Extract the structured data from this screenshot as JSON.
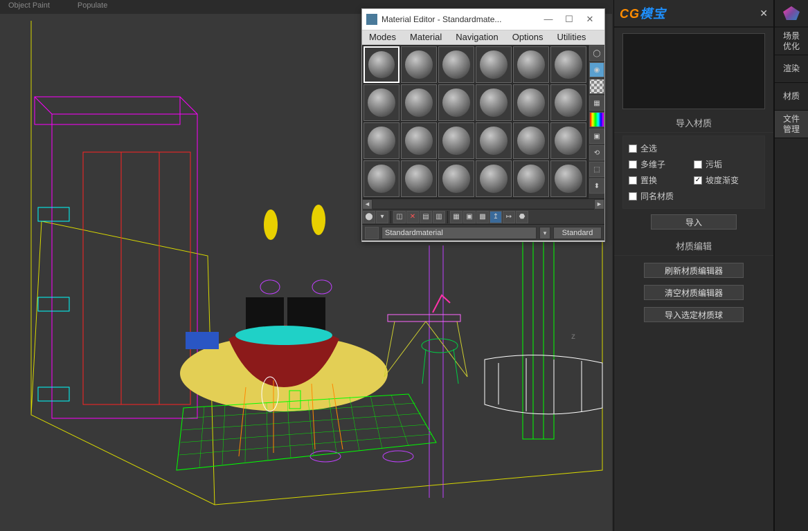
{
  "viewport": {
    "toolbar_items": [
      "Object Paint",
      "Populate"
    ]
  },
  "material_editor": {
    "title": "Material Editor - Standardmate...",
    "menus": [
      "Modes",
      "Material",
      "Navigation",
      "Options",
      "Utilities"
    ],
    "material_name": "Standardmaterial",
    "material_type": "Standard"
  },
  "plugin": {
    "logo_cg": "CG",
    "logo_cn": "模宝",
    "section_import": "导入材质",
    "ck_all": "全选",
    "ck_multi": "多维子",
    "ck_dirt": "污垢",
    "ck_displace": "置换",
    "ck_gradient": "坡度渐变",
    "ck_samename": "同名材质",
    "btn_import": "导入",
    "section_edit": "材质编辑",
    "btn_refresh": "刷新材质编辑器",
    "btn_clear": "清空材质编辑器",
    "btn_import_selected": "导入选定材质球"
  },
  "side_tabs": {
    "t1": "场景\n优化",
    "t2": "渲染",
    "t3": "材质",
    "t4": "文件\n管理"
  }
}
